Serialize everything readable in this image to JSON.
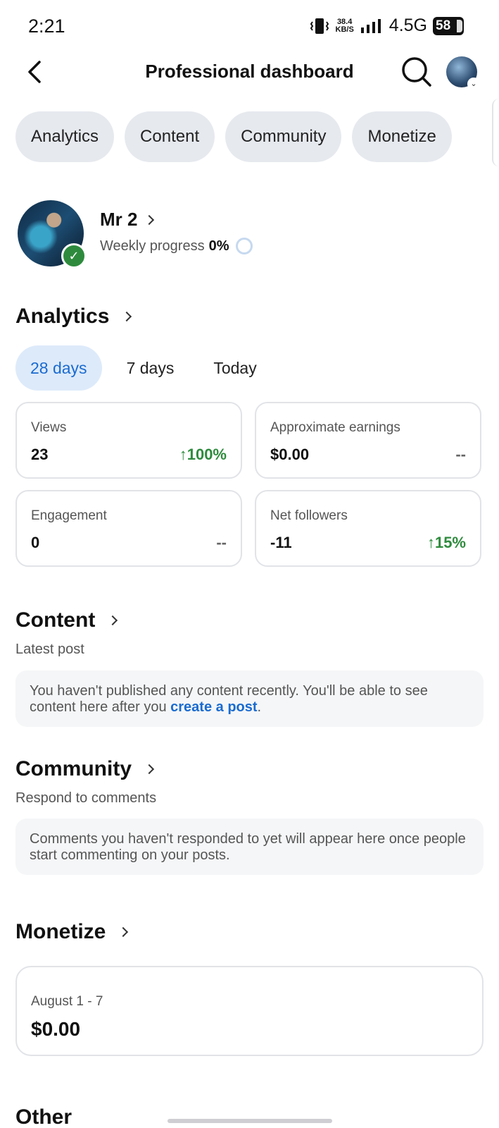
{
  "status_bar": {
    "time": "2:21",
    "speed_top": "38.4",
    "speed_bottom": "KB/S",
    "network": "4.5G",
    "battery": "58"
  },
  "header": {
    "title": "Professional dashboard"
  },
  "tabs": [
    "Analytics",
    "Content",
    "Community",
    "Monetize"
  ],
  "profile": {
    "name": "Mr 2",
    "weekly_label": "Weekly progress",
    "weekly_value": "0%"
  },
  "analytics": {
    "title": "Analytics",
    "ranges": [
      "28 days",
      "7 days",
      "Today"
    ],
    "active_range": "28 days",
    "cards": [
      {
        "label": "Views",
        "value": "23",
        "delta": "100%",
        "trend": "up"
      },
      {
        "label": "Approximate earnings",
        "value": "$0.00",
        "delta": "--",
        "trend": "none"
      },
      {
        "label": "Engagement",
        "value": "0",
        "delta": "--",
        "trend": "none"
      },
      {
        "label": "Net followers",
        "value": "-11",
        "delta": "15%",
        "trend": "up"
      }
    ]
  },
  "content": {
    "title": "Content",
    "subtitle": "Latest post",
    "message_prefix": "You haven't published any content recently. You'll be able to see content here after you ",
    "message_link": "create a post",
    "message_suffix": "."
  },
  "community": {
    "title": "Community",
    "subtitle": "Respond to comments",
    "message": "Comments you haven't responded to yet will appear here once people start commenting on your posts."
  },
  "monetize": {
    "title": "Monetize",
    "date_range": "August 1 - 7",
    "amount": "$0.00"
  },
  "other": {
    "title": "Other"
  },
  "colors": {
    "accent_blue": "#1a6bd0",
    "positive_green": "#2e8b3d",
    "chip_bg": "#e6e9ee",
    "active_range_bg": "#ddeafa"
  },
  "icons": {
    "back": "chevron-left-icon",
    "search": "search-icon",
    "verified": "check-icon",
    "trend_up": "arrow-up-icon"
  }
}
